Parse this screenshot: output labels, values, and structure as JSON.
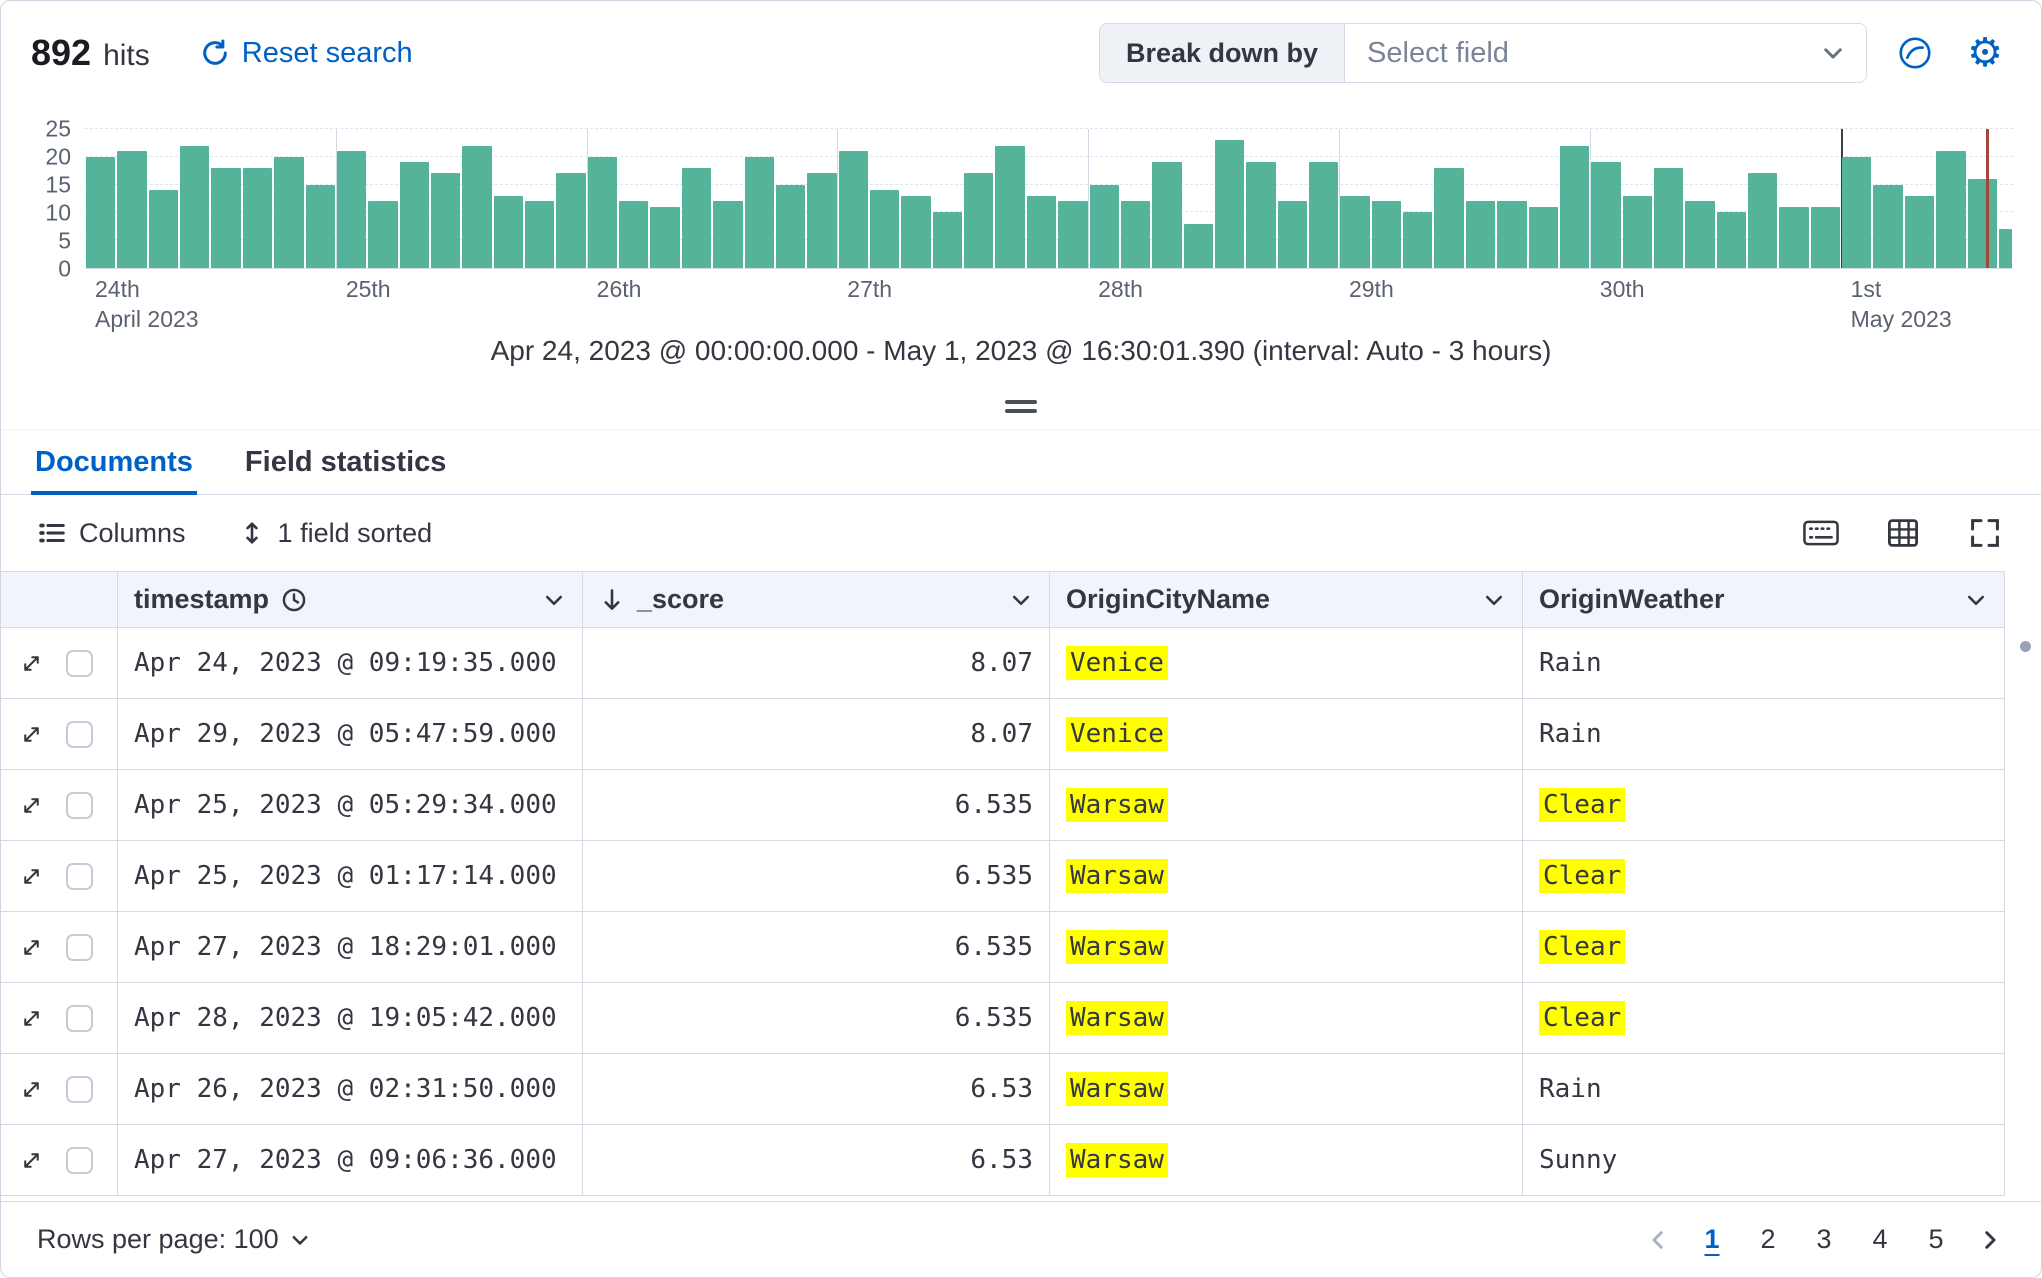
{
  "header": {
    "hits_count": "892",
    "hits_label": "hits",
    "reset_search": "Reset search",
    "breakdown_label": "Break down by",
    "breakdown_placeholder": "Select field"
  },
  "chart_data": {
    "type": "bar",
    "x_start": "Apr 24, 2023 @ 00:00:00.000",
    "x_end": "May 1, 2023 @ 16:30:01.390",
    "interval": "Auto - 3 hours",
    "caption": "Apr 24, 2023 @ 00:00:00.000 - May 1, 2023 @ 16:30:01.390 (interval: Auto - 3 hours)",
    "ylim": [
      0,
      25
    ],
    "y_ticks": [
      0,
      5,
      10,
      15,
      20,
      25
    ],
    "bar_color": "#54B399",
    "end_marker_frac": 0.986,
    "end_marker_color": "#A6453C",
    "values": [
      20,
      21,
      14,
      22,
      18,
      18,
      20,
      15,
      21,
      12,
      19,
      17,
      22,
      13,
      12,
      17,
      20,
      12,
      11,
      18,
      12,
      20,
      15,
      17,
      21,
      14,
      13,
      10,
      17,
      22,
      13,
      12,
      15,
      12,
      19,
      8,
      23,
      19,
      12,
      19,
      13,
      12,
      10,
      18,
      12,
      12,
      11,
      22,
      19,
      13,
      18,
      12,
      10,
      17,
      11,
      11,
      20,
      15,
      13,
      21,
      16,
      7
    ],
    "day_labels": [
      {
        "day": "24th",
        "sub": "April 2023",
        "frac": 0,
        "major": false
      },
      {
        "day": "25th",
        "sub": "",
        "frac": 0.1301,
        "major": false
      },
      {
        "day": "26th",
        "sub": "",
        "frac": 0.2602,
        "major": false
      },
      {
        "day": "27th",
        "sub": "",
        "frac": 0.3902,
        "major": false
      },
      {
        "day": "28th",
        "sub": "",
        "frac": 0.5203,
        "major": false
      },
      {
        "day": "29th",
        "sub": "",
        "frac": 0.6504,
        "major": false
      },
      {
        "day": "30th",
        "sub": "",
        "frac": 0.7805,
        "major": false
      },
      {
        "day": "1st",
        "sub": "May 2023",
        "frac": 0.9106,
        "major": true
      }
    ]
  },
  "tabs": [
    {
      "label": "Documents",
      "active": true
    },
    {
      "label": "Field statistics",
      "active": false
    }
  ],
  "toolbar": {
    "columns_label": "Columns",
    "sorted_label": "1 field sorted"
  },
  "table": {
    "headers": [
      {
        "label": "timestamp",
        "icon": "clock"
      },
      {
        "label": "_score",
        "icon": "arrow-down"
      },
      {
        "label": "OriginCityName"
      },
      {
        "label": "OriginWeather"
      }
    ],
    "rows": [
      {
        "timestamp": "Apr 24, 2023 @ 09:19:35.000",
        "score": "8.07",
        "city": "Venice",
        "city_highlight": true,
        "weather": "Rain",
        "weather_highlight": false
      },
      {
        "timestamp": "Apr 29, 2023 @ 05:47:59.000",
        "score": "8.07",
        "city": "Venice",
        "city_highlight": true,
        "weather": "Rain",
        "weather_highlight": false
      },
      {
        "timestamp": "Apr 25, 2023 @ 05:29:34.000",
        "score": "6.535",
        "city": "Warsaw",
        "city_highlight": true,
        "weather": "Clear",
        "weather_highlight": true
      },
      {
        "timestamp": "Apr 25, 2023 @ 01:17:14.000",
        "score": "6.535",
        "city": "Warsaw",
        "city_highlight": true,
        "weather": "Clear",
        "weather_highlight": true
      },
      {
        "timestamp": "Apr 27, 2023 @ 18:29:01.000",
        "score": "6.535",
        "city": "Warsaw",
        "city_highlight": true,
        "weather": "Clear",
        "weather_highlight": true
      },
      {
        "timestamp": "Apr 28, 2023 @ 19:05:42.000",
        "score": "6.535",
        "city": "Warsaw",
        "city_highlight": true,
        "weather": "Clear",
        "weather_highlight": true
      },
      {
        "timestamp": "Apr 26, 2023 @ 02:31:50.000",
        "score": "6.53",
        "city": "Warsaw",
        "city_highlight": true,
        "weather": "Rain",
        "weather_highlight": false
      },
      {
        "timestamp": "Apr 27, 2023 @ 09:06:36.000",
        "score": "6.53",
        "city": "Warsaw",
        "city_highlight": true,
        "weather": "Sunny",
        "weather_highlight": false
      }
    ]
  },
  "footer": {
    "rows_per_page_label": "Rows per page: 100",
    "pages": [
      "1",
      "2",
      "3",
      "4",
      "5"
    ],
    "current_page": "1"
  },
  "colors": {
    "accent_blue": "#0061c5",
    "border": "#d3dae6",
    "highlight_yellow": "#FFFF00",
    "bar_green": "#54B399"
  }
}
